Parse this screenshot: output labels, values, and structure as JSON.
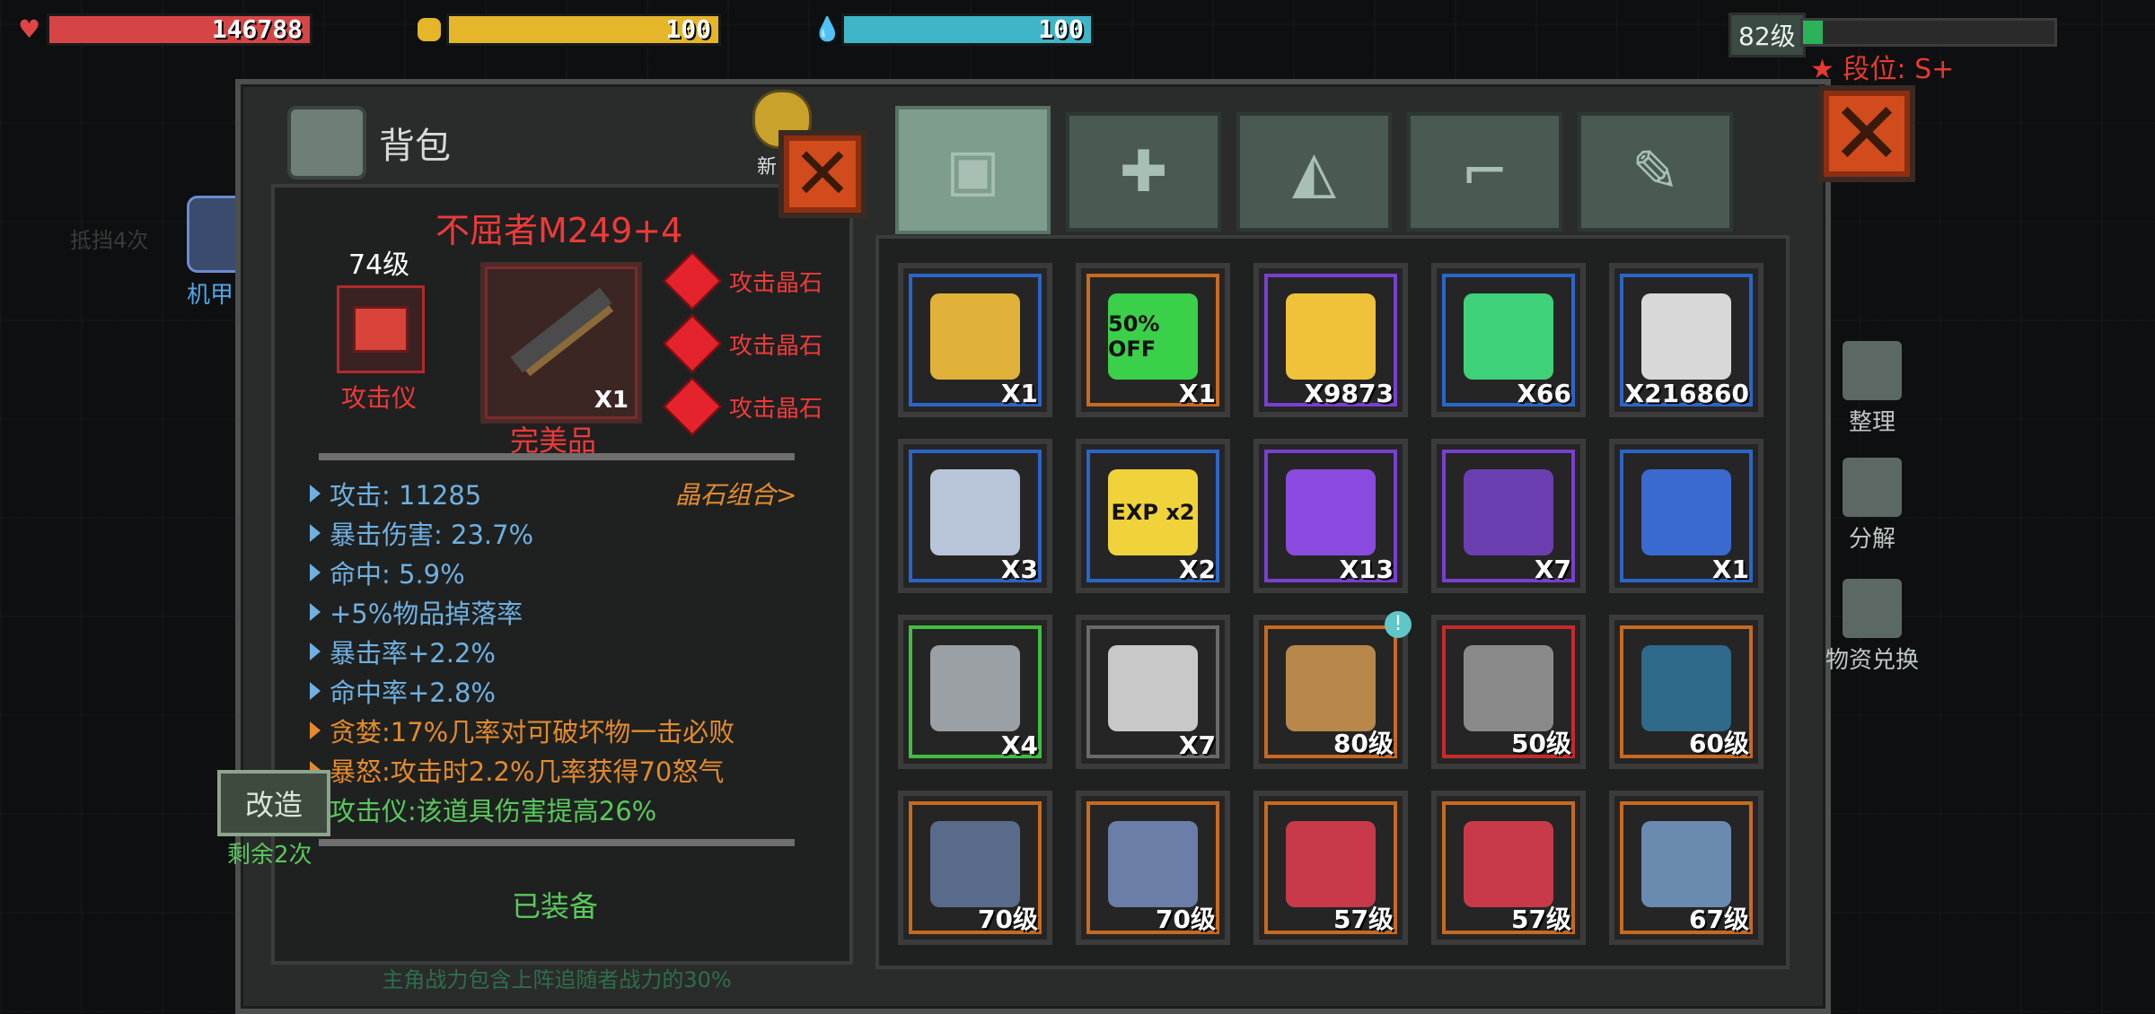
{
  "hud": {
    "hp": {
      "value": "146788",
      "color": "#d64545",
      "fill": 1.0
    },
    "food": {
      "value": "100",
      "color": "#e5b52a",
      "fill": 1.0
    },
    "water": {
      "value": "100",
      "color": "#3fb6c8",
      "fill": 1.0
    },
    "level": "82级",
    "level_progress": 0.08,
    "rank": "★ 段位: S+"
  },
  "panel": {
    "title": "背包",
    "close_label": "✕",
    "tabs": [
      "backpack",
      "medkit",
      "armor",
      "gun",
      "tools"
    ]
  },
  "side_left": {
    "mecha_label": "机甲",
    "ghost_text": "抵挡4次",
    "new_label": "新"
  },
  "item": {
    "name": "不屈者M249+4",
    "level": "74级",
    "attacker_label": "攻击仪",
    "quantity": "X1",
    "quality": "完美品",
    "gems": [
      "攻击晶石",
      "攻击晶石",
      "攻击晶石"
    ],
    "combo_link": "晶石组合>",
    "stats": [
      {
        "text": "攻击: 11285",
        "tone": "blue"
      },
      {
        "text": "暴击伤害: 23.7%",
        "tone": "blue"
      },
      {
        "text": "命中: 5.9%",
        "tone": "blue"
      },
      {
        "text": "+5%物品掉落率",
        "tone": "blue"
      },
      {
        "text": "暴击率+2.2%",
        "tone": "blue"
      },
      {
        "text": "命中率+2.8%",
        "tone": "blue"
      },
      {
        "text": "贪婪:17%几率对可破坏物一击必败",
        "tone": "orange"
      },
      {
        "text": "暴怒:攻击时2.2%几率获得70怒气",
        "tone": "orange"
      },
      {
        "text": "攻击仪:该道具伤害提高26%",
        "tone": "green"
      }
    ],
    "equipped": "已装备",
    "modify": "改造",
    "remaining": "剩余2次",
    "footer": "主角战力包含上阵追随者战力的30%"
  },
  "inventory": [
    {
      "name": "supply-crate-blue",
      "rarity": "blue",
      "qty": "X1",
      "color": "#e0b23a"
    },
    {
      "name": "sale-coupon",
      "rarity": "orange",
      "qty": "X1",
      "color": "#3bd04a",
      "caption": "50% OFF"
    },
    {
      "name": "gold-coin",
      "rarity": "purple",
      "qty": "X9873",
      "color": "#f0c23a"
    },
    {
      "name": "cocktail",
      "rarity": "blue",
      "qty": "X66",
      "color": "#3fd07a"
    },
    {
      "name": "silver-coin",
      "rarity": "blue",
      "qty": "X216860",
      "color": "#d8d8d8"
    },
    {
      "name": "map",
      "rarity": "blue",
      "qty": "X3",
      "color": "#b8c4d8"
    },
    {
      "name": "exp-card",
      "rarity": "blue",
      "qty": "X2",
      "color": "#f0d23a",
      "caption": "EXP x2"
    },
    {
      "name": "supply-crate-purple",
      "rarity": "purple",
      "qty": "X13",
      "color": "#8a4ae0"
    },
    {
      "name": "purple-chest",
      "rarity": "purple",
      "qty": "X7",
      "color": "#6b3fb0"
    },
    {
      "name": "blue-chest",
      "rarity": "blue",
      "qty": "X1",
      "color": "#3a6ad0"
    },
    {
      "name": "green-chest",
      "rarity": "green",
      "qty": "X4",
      "color": "#9aa0a4"
    },
    {
      "name": "grey-chest",
      "rarity": "grey",
      "qty": "X7",
      "color": "#c8c8c8"
    },
    {
      "name": "baseball-bat",
      "rarity": "orange",
      "qty": "80级",
      "color": "#b8884a",
      "badge": "!"
    },
    {
      "name": "hood-mask",
      "rarity": "red",
      "qty": "50级",
      "color": "#8a8a8a"
    },
    {
      "name": "cowboy-hat",
      "rarity": "orange",
      "qty": "60级",
      "color": "#2f6a8a"
    },
    {
      "name": "gas-mask-helmet",
      "rarity": "orange",
      "qty": "70级",
      "color": "#5a6a8a"
    },
    {
      "name": "armored-legs",
      "rarity": "orange",
      "qty": "70级",
      "color": "#6a7ea8"
    },
    {
      "name": "red-vest",
      "rarity": "orange",
      "qty": "57级",
      "color": "#c83a4a"
    },
    {
      "name": "red-vest-2",
      "rarity": "orange",
      "qty": "57级",
      "color": "#c83a4a"
    },
    {
      "name": "blue-armor",
      "rarity": "orange",
      "qty": "67级",
      "color": "#6a8ab0"
    }
  ],
  "actions": [
    {
      "label": "整理"
    },
    {
      "label": "分解"
    },
    {
      "label": "物资兑换"
    }
  ]
}
